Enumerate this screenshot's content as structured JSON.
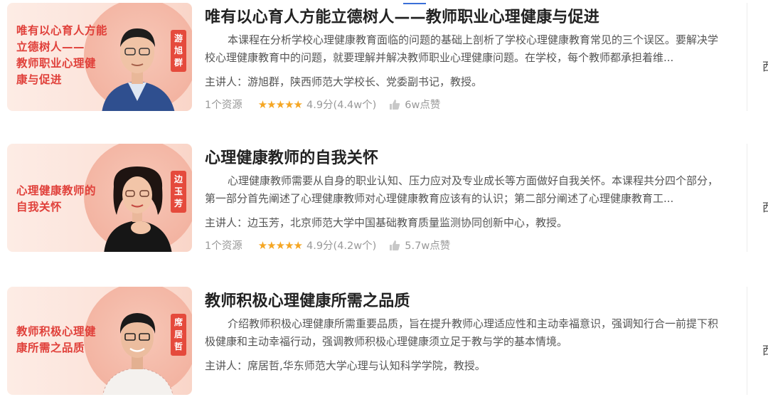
{
  "courses": [
    {
      "thumb_text": "唯有以心育人方能\n立德树人——\n教师职业心理健\n康与促进",
      "thumb_name": "游\n旭\n群",
      "title": "唯有以心育人方能立德树人——教师职业心理健康与促进",
      "desc": "本课程在分析学校心理健康教育面临的问题的基础上剖析了学校心理健康教育常见的三个误区。要解决学校心理健康教育中的问题，就要理解并解决教师职业心理健康问题。在学校，每个教师都承担着维...",
      "lecturer": "主讲人：游旭群，陕西师范大学校长、党委副书记，教授。",
      "resources": "1个资源",
      "stars": "★★★★★",
      "score": "4.9分(4.4w个)",
      "likes": "6w点赞",
      "edge_char": "西"
    },
    {
      "thumb_text": "心理健康教师的\n自我关怀",
      "thumb_name": "边\n玉\n芳",
      "title": "心理健康教师的自我关怀",
      "desc": "心理健康教师需要从自身的职业认知、压力应对及专业成长等方面做好自我关怀。本课程共分四个部分，第一部分首先阐述了心理健康教师对心理健康教育应该有的认识；第二部分阐述了心理健康教育工...",
      "lecturer": "主讲人：边玉芳，北京师范大学中国基础教育质量监测协同创新中心，教授。",
      "resources": "1个资源",
      "stars": "★★★★★",
      "score": "4.9分(4.2w个)",
      "likes": "5.7w点赞",
      "edge_char": "西"
    },
    {
      "thumb_text": "教师积极心理健\n康所需之品质",
      "thumb_name": "席\n居\n哲",
      "title": "教师积极心理健康所需之品质",
      "desc": "介绍教师积极心理健康所需重要品质，旨在提升教师心理适应性和主动幸福意识，强调知行合一前提下积极健康和主动幸福行动，强调教师积极心理健康须立足于教与学的基本情境。",
      "lecturer": "主讲人：席居哲,华东师范大学心理与认知科学学院，教授。",
      "resources": "",
      "stars": "",
      "score": "",
      "likes": "",
      "edge_char": "西"
    }
  ],
  "colors": {
    "accent_red": "#e0403a",
    "star": "#f5a623",
    "link_blue": "#3a6fd8"
  },
  "icons": {
    "like": "thumbs-up-icon",
    "star": "star-icon"
  }
}
